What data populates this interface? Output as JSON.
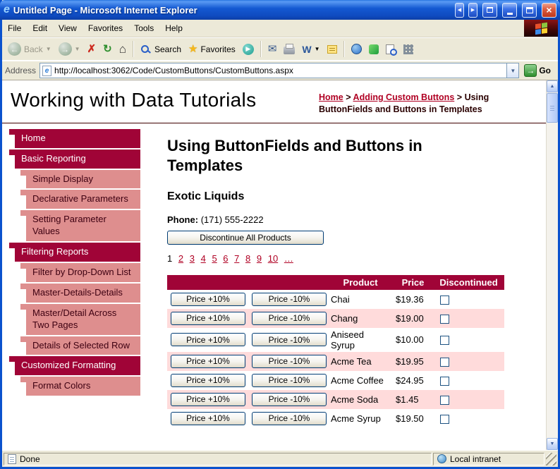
{
  "window": {
    "title": "Untitled Page - Microsoft Internet Explorer",
    "status": {
      "left": "Done",
      "right": "Local intranet"
    }
  },
  "menu": {
    "items": [
      "File",
      "Edit",
      "View",
      "Favorites",
      "Tools",
      "Help"
    ]
  },
  "toolbar": {
    "back": "Back",
    "search": "Search",
    "favorites": "Favorites",
    "edit": "W",
    "icons": [
      "back-icon",
      "forward-icon",
      "stop-icon",
      "refresh-icon",
      "home-icon",
      "search-icon",
      "favorites-icon",
      "media-icon",
      "mail-icon",
      "print-icon",
      "edit-icon",
      "discuss-icon",
      "globe-icon",
      "messenger-icon",
      "research-icon",
      "dots-grid-icon"
    ]
  },
  "address": {
    "label": "Address",
    "url": "http://localhost:3062/Code/CustomButtons/CustomButtons.aspx",
    "go": "Go"
  },
  "masthead": {
    "site_title": "Working with Data Tutorials"
  },
  "breadcrumb": {
    "home": "Home",
    "sep": ">",
    "section": "Adding Custom Buttons",
    "current": "Using ButtonFields and Buttons in Templates"
  },
  "sidebar": [
    {
      "label": "Home",
      "depth": 0
    },
    {
      "label": "Basic Reporting",
      "depth": 0
    },
    {
      "label": "Simple Display",
      "depth": 1
    },
    {
      "label": "Declarative Parameters",
      "depth": 1
    },
    {
      "label": "Setting Parameter Values",
      "depth": 1
    },
    {
      "label": "Filtering Reports",
      "depth": 0
    },
    {
      "label": "Filter by Drop-Down List",
      "depth": 1
    },
    {
      "label": "Master-Details-Details",
      "depth": 1
    },
    {
      "label": "Master/Detail Across Two Pages",
      "depth": 1
    },
    {
      "label": "Details of Selected Row",
      "depth": 1
    },
    {
      "label": "Customized Formatting",
      "depth": 0
    },
    {
      "label": "Format Colors",
      "depth": 1
    }
  ],
  "content": {
    "heading": "Using ButtonFields and Buttons in Templates",
    "supplier": "Exotic Liquids",
    "phone_label": "Phone:",
    "phone": "(171) 555-2222",
    "discontinue_button": "Discontinue All Products",
    "pager": [
      "1",
      "2",
      "3",
      "4",
      "5",
      "6",
      "7",
      "8",
      "9",
      "10",
      "…"
    ]
  },
  "table": {
    "headers": {
      "product": "Product",
      "price": "Price",
      "discontinued": "Discontinued"
    },
    "increase": "Price +10%",
    "decrease": "Price -10%",
    "rows": [
      {
        "product": "Chai",
        "price": "$19.36",
        "discontinued": false
      },
      {
        "product": "Chang",
        "price": "$19.00",
        "discontinued": false
      },
      {
        "product": "Aniseed Syrup",
        "price": "$10.00",
        "discontinued": false
      },
      {
        "product": "Acme Tea",
        "price": "$19.95",
        "discontinued": false
      },
      {
        "product": "Acme Coffee",
        "price": "$24.95",
        "discontinued": false
      },
      {
        "product": "Acme Soda",
        "price": "$1.45",
        "discontinued": false
      },
      {
        "product": "Acme Syrup",
        "price": "$19.50",
        "discontinued": false
      }
    ]
  },
  "colors": {
    "accent_crimson": "#A00437",
    "sidebar_subitem_pink": "#DE8E8E",
    "row_alt_pink": "#FFDBDB",
    "link_red": "#B00023",
    "titlebar_blue": "#1459D2",
    "chrome_beige": "#ECE9D8"
  }
}
